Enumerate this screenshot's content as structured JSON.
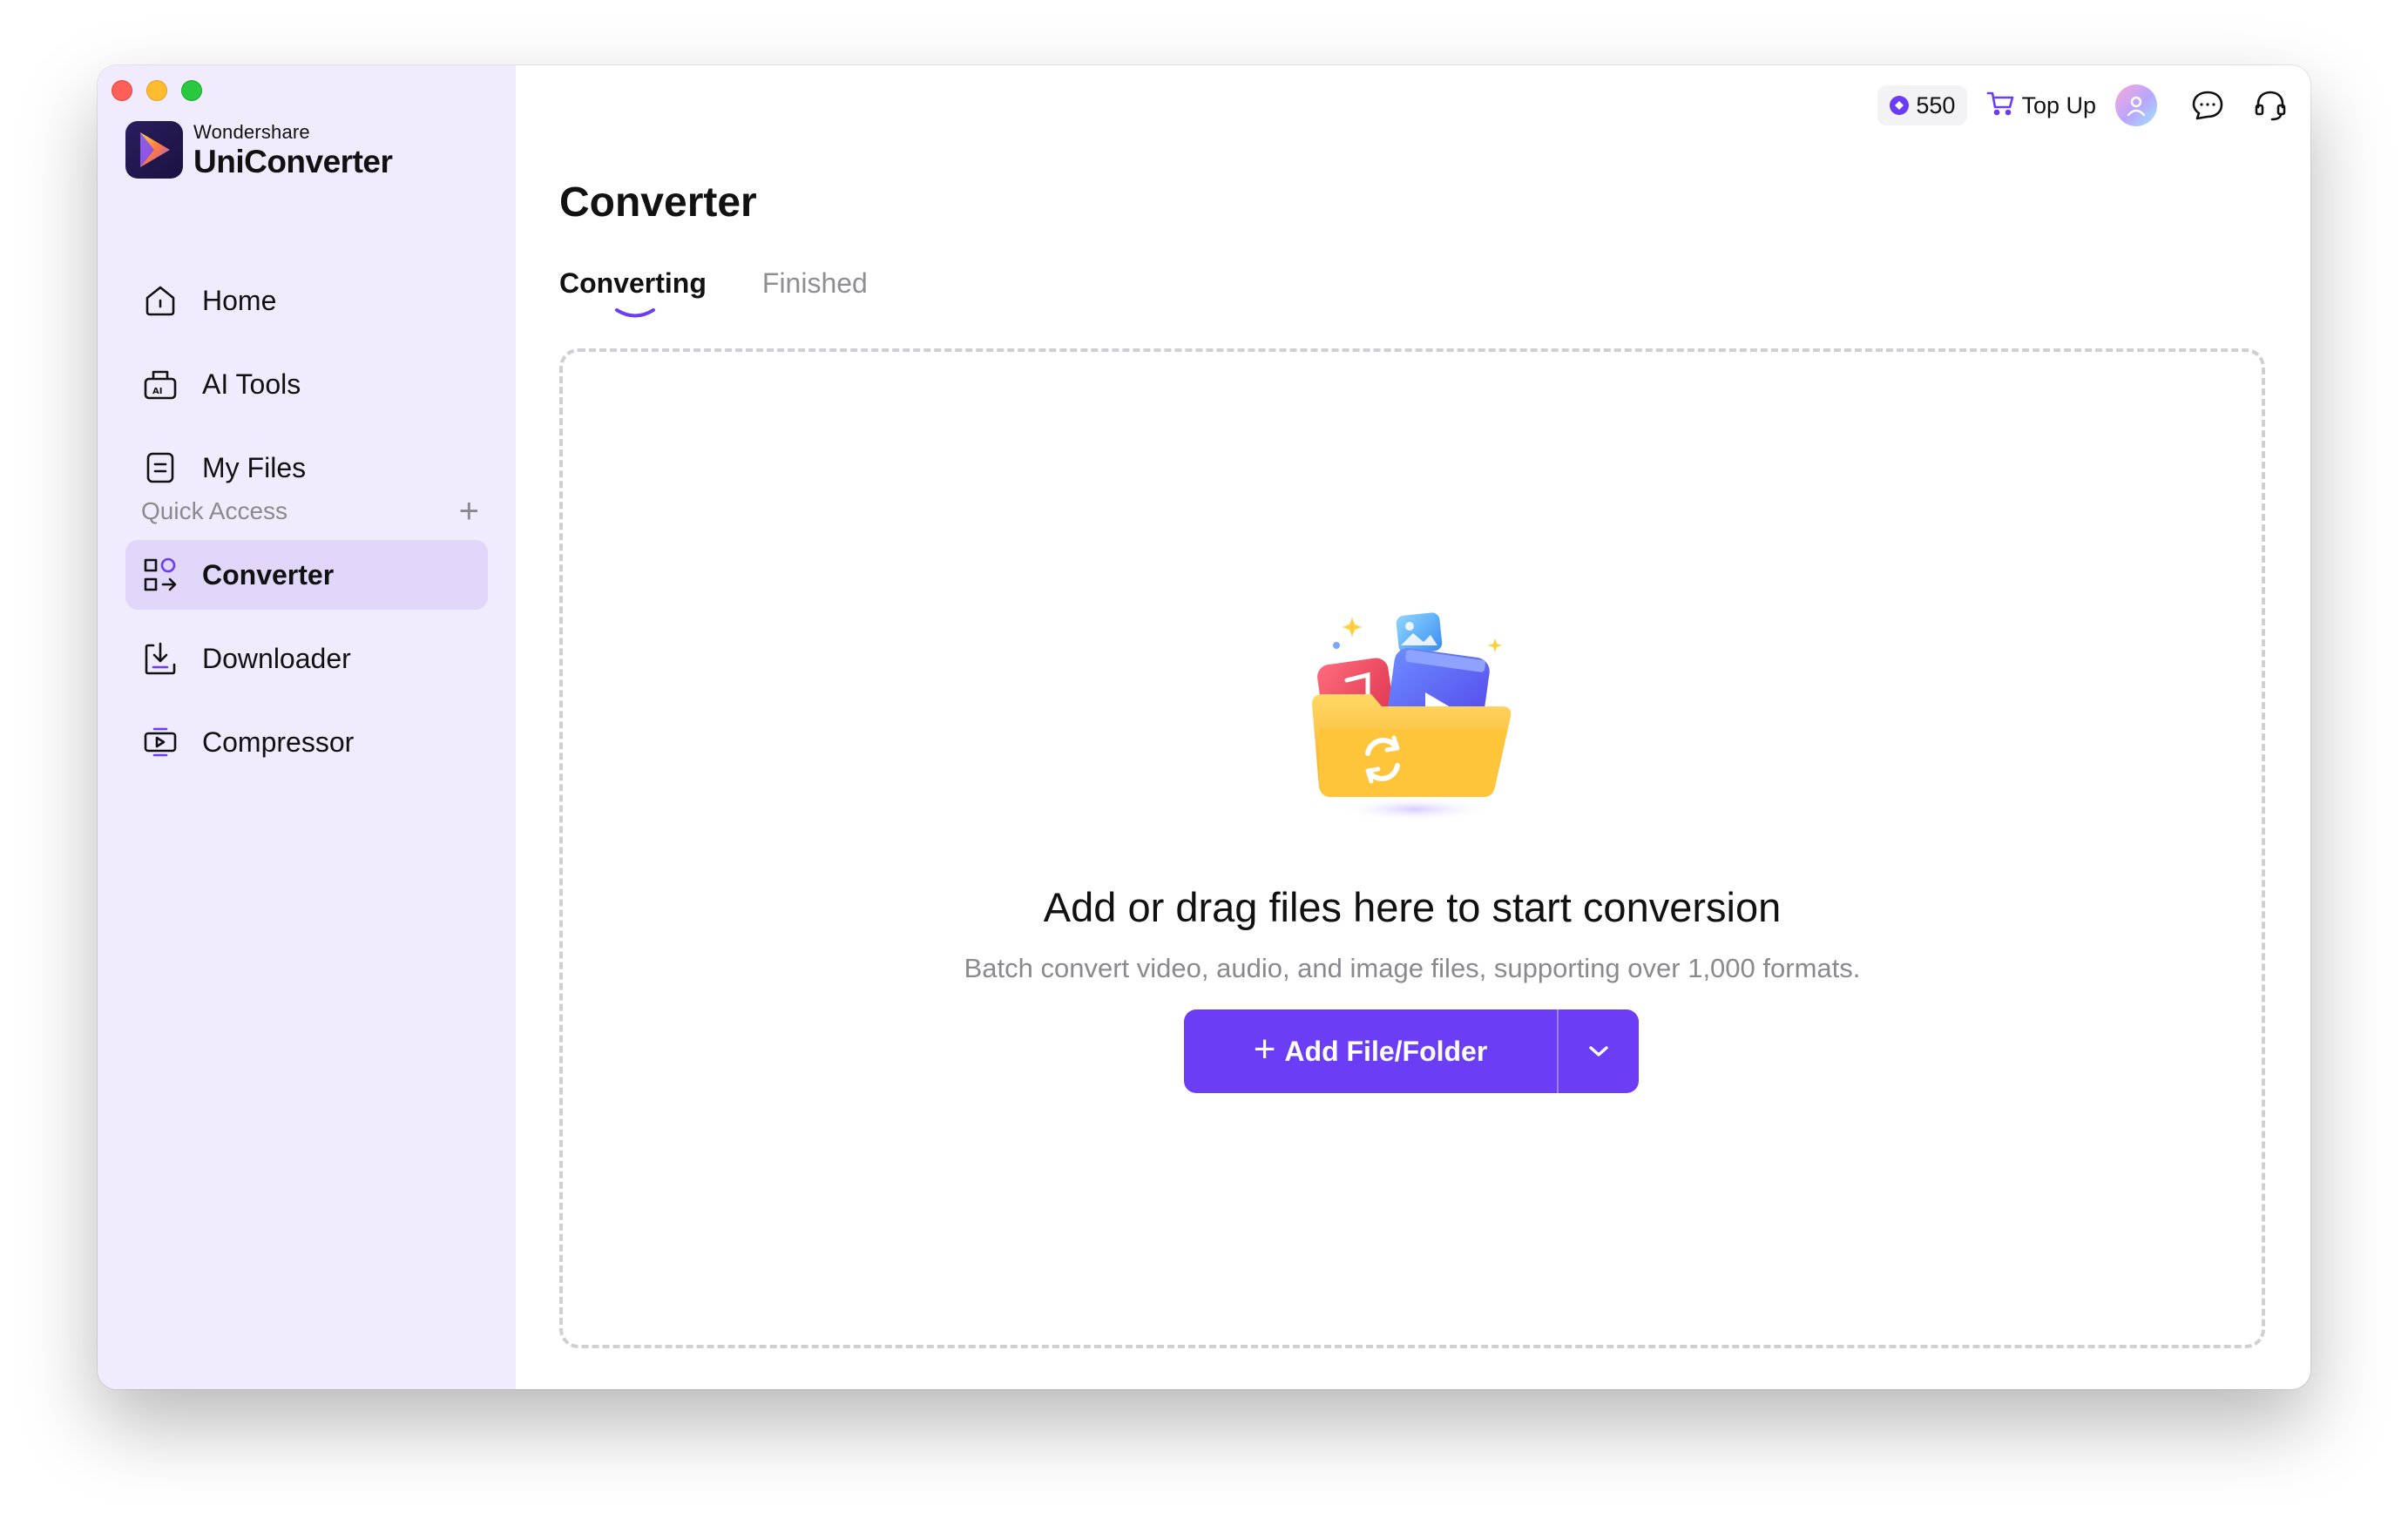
{
  "brand": {
    "sub": "Wondershare",
    "main": "UniConverter"
  },
  "sidebar": {
    "items": [
      {
        "label": "Home",
        "icon": "home-icon"
      },
      {
        "label": "AI Tools",
        "icon": "ai-tools-icon"
      },
      {
        "label": "My Files",
        "icon": "my-files-icon"
      }
    ],
    "quick_access_label": "Quick Access",
    "quick_items": [
      {
        "label": "Converter",
        "icon": "converter-icon",
        "active": true
      },
      {
        "label": "Downloader",
        "icon": "downloader-icon"
      },
      {
        "label": "Compressor",
        "icon": "compressor-icon"
      }
    ]
  },
  "topbar": {
    "credits": "550",
    "topup_label": "Top Up"
  },
  "main": {
    "title": "Converter",
    "tabs": [
      {
        "label": "Converting",
        "active": true
      },
      {
        "label": "Finished",
        "active": false
      }
    ],
    "dropzone": {
      "title": "Add or drag files here to start conversion",
      "subtitle": "Batch convert video, audio, and image files, supporting over 1,000 formats.",
      "button_label": "Add File/Folder"
    }
  },
  "colors": {
    "accent": "#6b3df5",
    "sidebar_bg": "#f1ecfd",
    "active_item_bg": "#e1d7fb"
  }
}
